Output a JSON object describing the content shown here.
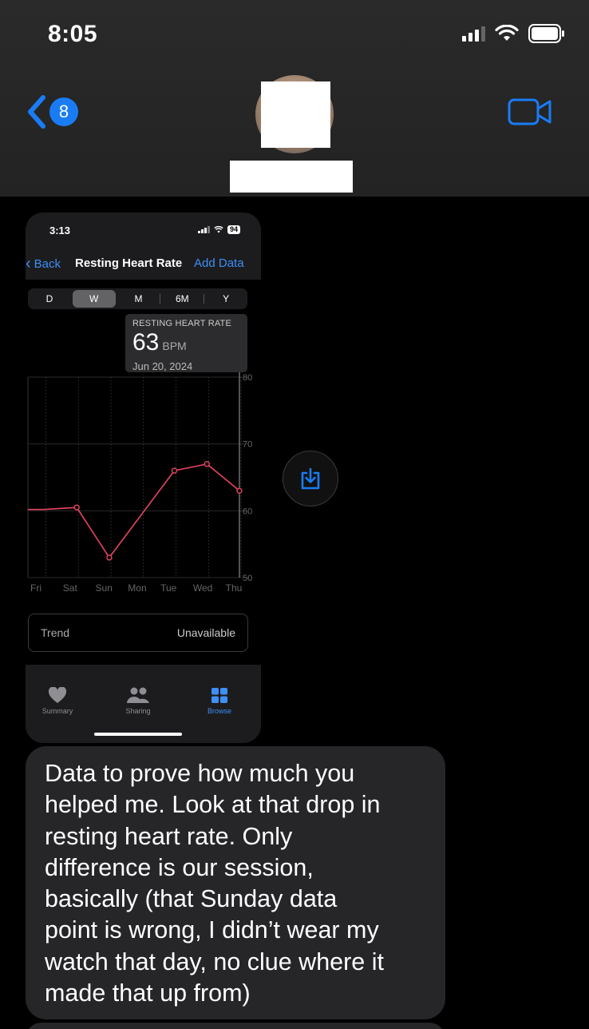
{
  "status_bar": {
    "time": "8:05"
  },
  "conversation": {
    "unread_badge": "8"
  },
  "attachment": {
    "status_time": "3:13",
    "battery": "94",
    "nav": {
      "back_label": "Back",
      "title": "Resting Heart Rate",
      "add_label": "Add Data"
    },
    "segments": [
      "D",
      "W",
      "M",
      "6M",
      "Y"
    ],
    "selected_segment": "W",
    "tooltip": {
      "label": "RESTING HEART RATE",
      "value": "63",
      "unit": "BPM",
      "date": "Jun 20, 2024"
    },
    "chart_data": {
      "type": "line",
      "x": [
        "Fri",
        "Sat",
        "Sun",
        "Mon",
        "Tue",
        "Wed",
        "Thu"
      ],
      "series": [
        {
          "values": [
            60.2,
            60.5,
            53,
            null,
            66,
            67,
            63
          ]
        }
      ],
      "y_ticks": [
        "80",
        "70",
        "60",
        "50"
      ],
      "ylim": [
        50,
        80
      ],
      "line_color": "#e8455f",
      "grid": true,
      "selected_x": "Thu"
    },
    "trend": {
      "label": "Trend",
      "value": "Unavailable"
    },
    "tabs": [
      {
        "label": "Summary",
        "icon": "heart-icon"
      },
      {
        "label": "Sharing",
        "icon": "people-icon"
      },
      {
        "label": "Browse",
        "icon": "grid-icon"
      }
    ]
  },
  "message": {
    "text": "Data to prove how much you\nhelped me. Look at that drop in\nresting heart rate. Only\ndifference is our session,\nbasically (that Sunday data\npoint is wrong, I didn’t wear my\nwatch that day, no clue where it\nmade that up from)"
  },
  "colors": {
    "accent": "#1a7cf5",
    "ios_blue": "#3e8ff6",
    "bubble": "#262629",
    "chart_line": "#e8455f"
  }
}
